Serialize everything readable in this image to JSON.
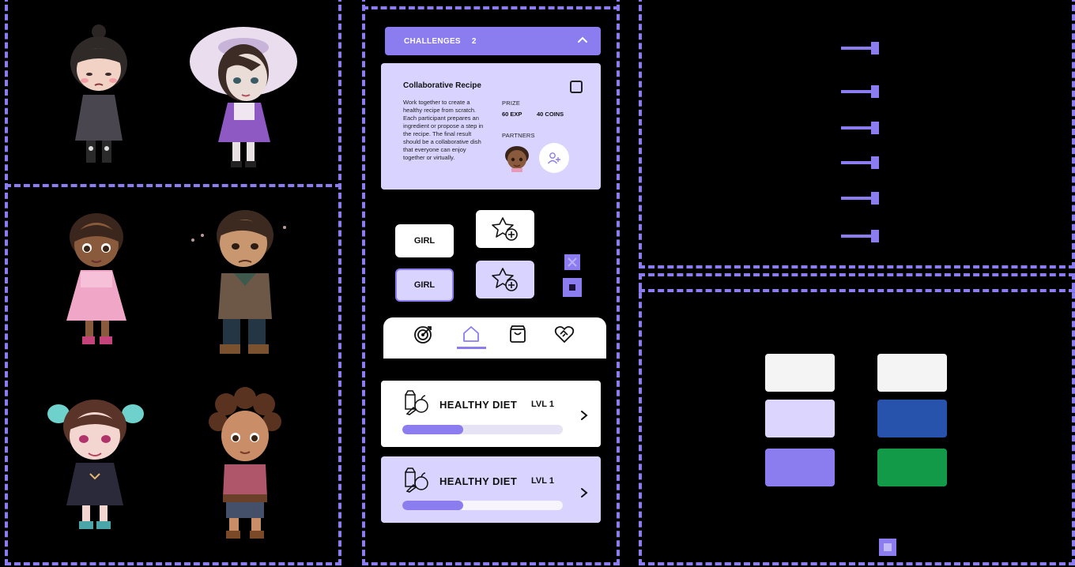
{
  "characters": [
    {
      "name": "girl-gray-dress"
    },
    {
      "name": "girl-purple-bonnet"
    },
    {
      "name": "girl-pink-dress"
    },
    {
      "name": "boy-brown-shirt"
    },
    {
      "name": "girl-navy-dress"
    },
    {
      "name": "girl-curly-hair"
    }
  ],
  "challenges": {
    "header_label": "CHALLENGES",
    "count": "2",
    "card": {
      "title": "Collaborative Recipe",
      "description": "Work together to create a healthy recipe from scratch. Each participant prepares an ingredient or propose a step in the recipe. The final result should be a collaborative dish that everyone can enjoy together or virtually.",
      "prize_label": "PRIZE",
      "prize_exp": "60 EXP",
      "prize_coins": "40 COINS",
      "partners_label": "PARTNERS"
    }
  },
  "buttons": {
    "girl_default": "GIRL",
    "girl_selected": "GIRL"
  },
  "nav": {
    "items": [
      {
        "icon": "target-icon"
      },
      {
        "icon": "home-icon",
        "active": true
      },
      {
        "icon": "shopping-bag-icon"
      },
      {
        "icon": "heart-handshake-icon"
      }
    ]
  },
  "diet_cards": [
    {
      "title": "HEALTHY DIET",
      "level": "LVL 1",
      "progress": 0.38,
      "variant": "white"
    },
    {
      "title": "HEALTHY DIET",
      "level": "LVL 1",
      "progress": 0.38,
      "variant": "lavender"
    }
  ],
  "colors": {
    "accent": "#8b7cf0",
    "swatches": [
      "#f4f4f4",
      "#f4f4f4",
      "#dcd6ff",
      "#2853ad",
      "#8b7cf0",
      "#139a48"
    ]
  }
}
